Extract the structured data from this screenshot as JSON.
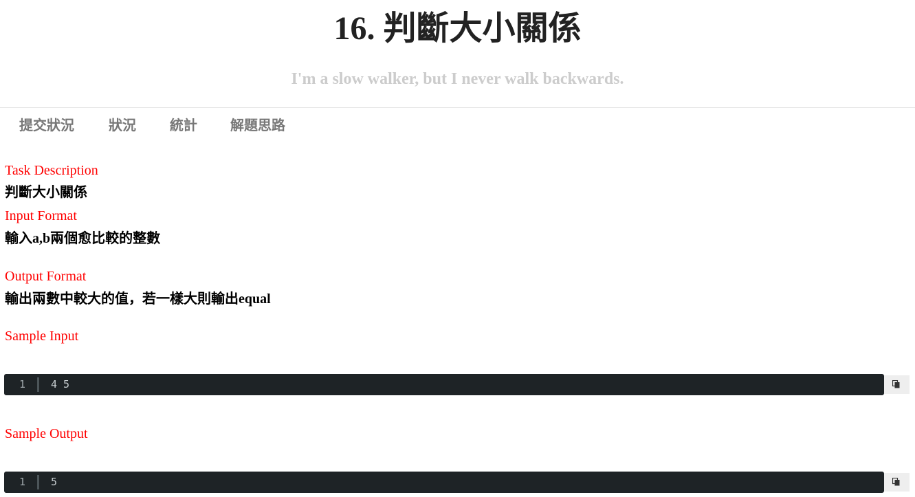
{
  "header": {
    "title": "16. 判斷大小關係",
    "subtitle": "I'm a slow walker, but I never walk backwards."
  },
  "tabs": [
    {
      "label": "提交狀況"
    },
    {
      "label": "狀況"
    },
    {
      "label": "統計"
    },
    {
      "label": "解題思路"
    }
  ],
  "task": {
    "description_label": "Task Description",
    "description_text": "判斷大小關係",
    "input_label": "Input Format",
    "input_text": "輸入a,b兩個愈比較的整數",
    "output_label": "Output Format",
    "output_text": "輸出兩數中較大的值，若一樣大則輸出equal",
    "sample_input_label": "Sample Input",
    "sample_output_label": "Sample Output"
  },
  "sample_input": {
    "line_number": "1",
    "code": "4 5"
  },
  "sample_output": {
    "line_number": "1",
    "code": "5"
  },
  "icons": {
    "copy": "copy-icon"
  }
}
